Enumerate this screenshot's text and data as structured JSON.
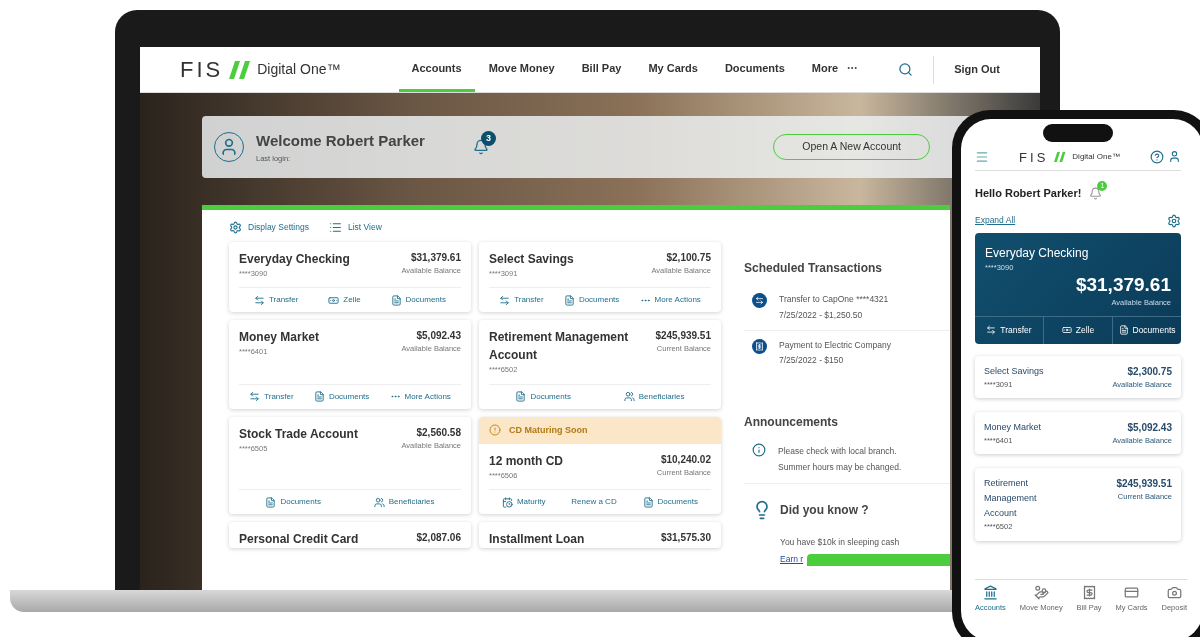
{
  "laptop": {
    "brand": {
      "mark": "FIS",
      "product": "Digital One™"
    },
    "nav": [
      {
        "label": "Accounts",
        "selected": true
      },
      {
        "label": "Move Money",
        "selected": false
      },
      {
        "label": "Bill Pay",
        "selected": false
      },
      {
        "label": "My Cards",
        "selected": false
      },
      {
        "label": "Documents",
        "selected": false
      },
      {
        "label": "More",
        "selected": false
      }
    ],
    "sign_out": "Sign Out",
    "welcome": {
      "title": "Welcome Robert Parker",
      "subtitle": "Last login:",
      "notifications": "3",
      "button": "Open A New Account"
    },
    "toolbar": [
      {
        "label": "Display Settings",
        "kind": "gear"
      },
      {
        "label": "List View",
        "kind": "list"
      }
    ],
    "accounts": [
      {
        "name": "Everyday Checking",
        "number": "****3090",
        "balance": "$31,379.61",
        "balance_label": "Available Balance",
        "actions": [
          {
            "label": "Transfer",
            "kind": "transfer"
          },
          {
            "label": "Zelle",
            "kind": "zelle"
          },
          {
            "label": "Documents",
            "kind": "documents"
          }
        ]
      },
      {
        "name": "Select Savings",
        "number": "****3091",
        "balance": "$2,100.75",
        "balance_label": "Available Balance",
        "actions": [
          {
            "label": "Transfer",
            "kind": "transfer"
          },
          {
            "label": "Documents",
            "kind": "documents"
          },
          {
            "label": "More Actions",
            "kind": "more"
          }
        ]
      },
      {
        "name": "Money Market",
        "number": "****6401",
        "balance": "$5,092.43",
        "balance_label": "Available Balance",
        "actions": [
          {
            "label": "Transfer",
            "kind": "transfer"
          },
          {
            "label": "Documents",
            "kind": "documents"
          },
          {
            "label": "More Actions",
            "kind": "more"
          }
        ]
      },
      {
        "name": "Retirement Management Account",
        "number": "****6502",
        "balance": "$245,939.51",
        "balance_label": "Current Balance",
        "actions": [
          {
            "label": "Documents",
            "kind": "documents"
          },
          {
            "label": "Beneficiaries",
            "kind": "beneficiaries"
          }
        ]
      },
      {
        "name": "Stock Trade Account",
        "number": "****6505",
        "balance": "$2,560.58",
        "balance_label": "Available Balance",
        "actions": [
          {
            "label": "Documents",
            "kind": "documents"
          },
          {
            "label": "Beneficiaries",
            "kind": "beneficiaries"
          }
        ]
      },
      {
        "banner": "CD Maturing Soon",
        "name": "12 month CD",
        "number": "****6506",
        "balance": "$10,240.02",
        "balance_label": "Current Balance",
        "actions": [
          {
            "label": "Maturity",
            "kind": "maturity"
          },
          {
            "label": "Renew a CD",
            "kind": "text"
          },
          {
            "label": "Documents",
            "kind": "documents"
          }
        ]
      },
      {
        "name": "Personal Credit Card",
        "balance": "$2,087.06"
      },
      {
        "name": "Installment Loan",
        "balance": "$31,575.30"
      }
    ],
    "scheduled": {
      "title": "Scheduled Transactions",
      "items": [
        {
          "kind": "transfer",
          "title": "Transfer to CapOne ****4321",
          "detail": "7/25/2022 - $1,250.50"
        },
        {
          "kind": "payment",
          "title": "Payment to Electric Company",
          "detail": "7/25/2022 - $150"
        }
      ]
    },
    "announcements": {
      "title": "Announcements",
      "items": [
        "Please check with local branch. Summer hours may be changed."
      ]
    },
    "did_you_know": {
      "title": "Did you know ?",
      "text": "You have $10k in sleeping cash",
      "link": "Earn r"
    }
  },
  "phone": {
    "brand": {
      "mark": "FIS",
      "product": "Digital One™"
    },
    "greeting": "Hello Robert Parker!",
    "notifications": "1",
    "expand": "Expand All",
    "featured": {
      "name": "Everyday Checking",
      "number": "****3090",
      "balance": "$31,379.61",
      "balance_label": "Available Balance",
      "actions": [
        {
          "label": "Transfer",
          "kind": "transfer"
        },
        {
          "label": "Zelle",
          "kind": "zelle"
        },
        {
          "label": "Documents",
          "kind": "documents"
        }
      ]
    },
    "accounts": [
      {
        "name": "Select Savings",
        "number": "****3091",
        "balance": "$2,300.75",
        "balance_label": "Available Balance"
      },
      {
        "name": "Money Market",
        "number": "****6401",
        "balance": "$5,092.43",
        "balance_label": "Available Balance"
      },
      {
        "name": "Retirement Management Account",
        "number": "****6502",
        "balance": "$245,939.51",
        "balance_label": "Current Balance"
      }
    ],
    "tabs": [
      {
        "label": "Accounts",
        "kind": "bank",
        "selected": true
      },
      {
        "label": "Move Money",
        "kind": "money",
        "selected": false
      },
      {
        "label": "Bill Pay",
        "kind": "bill",
        "selected": false
      },
      {
        "label": "My Cards",
        "kind": "cards",
        "selected": false
      },
      {
        "label": "Deposit",
        "kind": "camera",
        "selected": false
      }
    ]
  }
}
